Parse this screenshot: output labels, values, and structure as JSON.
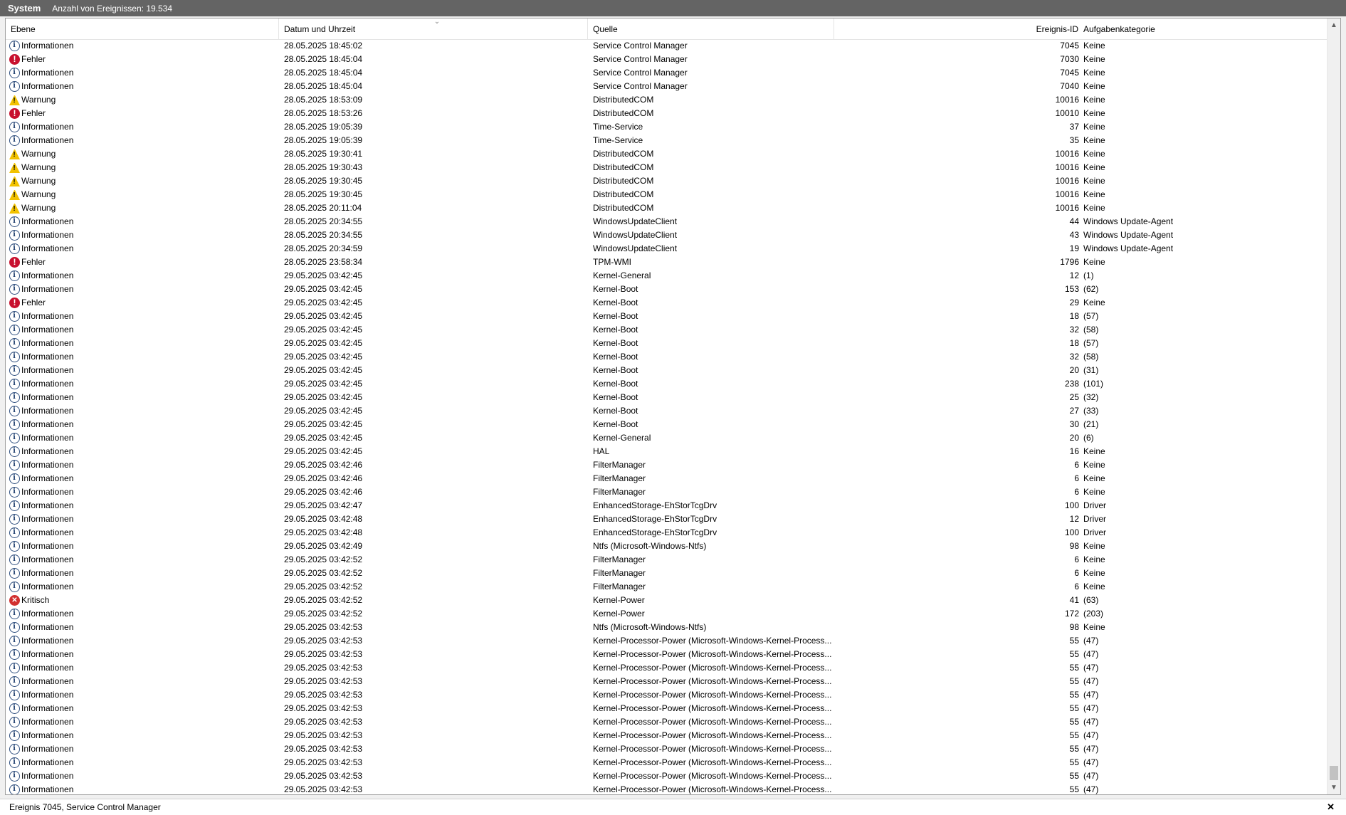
{
  "window": {
    "log_name": "System",
    "event_count": "Anzahl von Ereignissen: 19.534"
  },
  "columns": {
    "level": "Ebene",
    "datetime": "Datum und Uhrzeit",
    "source": "Quelle",
    "event_id": "Ereignis-ID",
    "category": "Aufgabenkategorie"
  },
  "icons": {
    "info": "info-icon",
    "error": "error-icon",
    "warning": "warning-icon",
    "critical": "critical-icon",
    "sort": "sort-caret-icon",
    "scroll_up": "scroll-up-icon",
    "scroll_down": "scroll-down-icon",
    "close": "close-icon"
  },
  "colors": {
    "titlebar": "#646464",
    "error": "#c8102e",
    "warning": "#f2c200",
    "info": "#2f4f7f"
  },
  "events": [
    {
      "level": "Informationen",
      "type": "info",
      "date": "28.05.2025 18:45:02",
      "source": "Service Control Manager",
      "id": "7045",
      "category": "Keine"
    },
    {
      "level": "Fehler",
      "type": "error",
      "date": "28.05.2025 18:45:04",
      "source": "Service Control Manager",
      "id": "7030",
      "category": "Keine"
    },
    {
      "level": "Informationen",
      "type": "info",
      "date": "28.05.2025 18:45:04",
      "source": "Service Control Manager",
      "id": "7045",
      "category": "Keine"
    },
    {
      "level": "Informationen",
      "type": "info",
      "date": "28.05.2025 18:45:04",
      "source": "Service Control Manager",
      "id": "7040",
      "category": "Keine"
    },
    {
      "level": "Warnung",
      "type": "warning",
      "date": "28.05.2025 18:53:09",
      "source": "DistributedCOM",
      "id": "10016",
      "category": "Keine"
    },
    {
      "level": "Fehler",
      "type": "error",
      "date": "28.05.2025 18:53:26",
      "source": "DistributedCOM",
      "id": "10010",
      "category": "Keine"
    },
    {
      "level": "Informationen",
      "type": "info",
      "date": "28.05.2025 19:05:39",
      "source": "Time-Service",
      "id": "37",
      "category": "Keine"
    },
    {
      "level": "Informationen",
      "type": "info",
      "date": "28.05.2025 19:05:39",
      "source": "Time-Service",
      "id": "35",
      "category": "Keine"
    },
    {
      "level": "Warnung",
      "type": "warning",
      "date": "28.05.2025 19:30:41",
      "source": "DistributedCOM",
      "id": "10016",
      "category": "Keine"
    },
    {
      "level": "Warnung",
      "type": "warning",
      "date": "28.05.2025 19:30:43",
      "source": "DistributedCOM",
      "id": "10016",
      "category": "Keine"
    },
    {
      "level": "Warnung",
      "type": "warning",
      "date": "28.05.2025 19:30:45",
      "source": "DistributedCOM",
      "id": "10016",
      "category": "Keine"
    },
    {
      "level": "Warnung",
      "type": "warning",
      "date": "28.05.2025 19:30:45",
      "source": "DistributedCOM",
      "id": "10016",
      "category": "Keine"
    },
    {
      "level": "Warnung",
      "type": "warning",
      "date": "28.05.2025 20:11:04",
      "source": "DistributedCOM",
      "id": "10016",
      "category": "Keine"
    },
    {
      "level": "Informationen",
      "type": "info",
      "date": "28.05.2025 20:34:55",
      "source": "WindowsUpdateClient",
      "id": "44",
      "category": "Windows Update-Agent"
    },
    {
      "level": "Informationen",
      "type": "info",
      "date": "28.05.2025 20:34:55",
      "source": "WindowsUpdateClient",
      "id": "43",
      "category": "Windows Update-Agent"
    },
    {
      "level": "Informationen",
      "type": "info",
      "date": "28.05.2025 20:34:59",
      "source": "WindowsUpdateClient",
      "id": "19",
      "category": "Windows Update-Agent"
    },
    {
      "level": "Fehler",
      "type": "error",
      "date": "28.05.2025 23:58:34",
      "source": "TPM-WMI",
      "id": "1796",
      "category": "Keine"
    },
    {
      "level": "Informationen",
      "type": "info",
      "date": "29.05.2025 03:42:45",
      "source": "Kernel-General",
      "id": "12",
      "category": "(1)"
    },
    {
      "level": "Informationen",
      "type": "info",
      "date": "29.05.2025 03:42:45",
      "source": "Kernel-Boot",
      "id": "153",
      "category": "(62)"
    },
    {
      "level": "Fehler",
      "type": "error",
      "date": "29.05.2025 03:42:45",
      "source": "Kernel-Boot",
      "id": "29",
      "category": "Keine"
    },
    {
      "level": "Informationen",
      "type": "info",
      "date": "29.05.2025 03:42:45",
      "source": "Kernel-Boot",
      "id": "18",
      "category": "(57)"
    },
    {
      "level": "Informationen",
      "type": "info",
      "date": "29.05.2025 03:42:45",
      "source": "Kernel-Boot",
      "id": "32",
      "category": "(58)"
    },
    {
      "level": "Informationen",
      "type": "info",
      "date": "29.05.2025 03:42:45",
      "source": "Kernel-Boot",
      "id": "18",
      "category": "(57)"
    },
    {
      "level": "Informationen",
      "type": "info",
      "date": "29.05.2025 03:42:45",
      "source": "Kernel-Boot",
      "id": "32",
      "category": "(58)"
    },
    {
      "level": "Informationen",
      "type": "info",
      "date": "29.05.2025 03:42:45",
      "source": "Kernel-Boot",
      "id": "20",
      "category": "(31)"
    },
    {
      "level": "Informationen",
      "type": "info",
      "date": "29.05.2025 03:42:45",
      "source": "Kernel-Boot",
      "id": "238",
      "category": "(101)"
    },
    {
      "level": "Informationen",
      "type": "info",
      "date": "29.05.2025 03:42:45",
      "source": "Kernel-Boot",
      "id": "25",
      "category": "(32)"
    },
    {
      "level": "Informationen",
      "type": "info",
      "date": "29.05.2025 03:42:45",
      "source": "Kernel-Boot",
      "id": "27",
      "category": "(33)"
    },
    {
      "level": "Informationen",
      "type": "info",
      "date": "29.05.2025 03:42:45",
      "source": "Kernel-Boot",
      "id": "30",
      "category": "(21)"
    },
    {
      "level": "Informationen",
      "type": "info",
      "date": "29.05.2025 03:42:45",
      "source": "Kernel-General",
      "id": "20",
      "category": "(6)"
    },
    {
      "level": "Informationen",
      "type": "info",
      "date": "29.05.2025 03:42:45",
      "source": "HAL",
      "id": "16",
      "category": "Keine"
    },
    {
      "level": "Informationen",
      "type": "info",
      "date": "29.05.2025 03:42:46",
      "source": "FilterManager",
      "id": "6",
      "category": "Keine"
    },
    {
      "level": "Informationen",
      "type": "info",
      "date": "29.05.2025 03:42:46",
      "source": "FilterManager",
      "id": "6",
      "category": "Keine"
    },
    {
      "level": "Informationen",
      "type": "info",
      "date": "29.05.2025 03:42:46",
      "source": "FilterManager",
      "id": "6",
      "category": "Keine"
    },
    {
      "level": "Informationen",
      "type": "info",
      "date": "29.05.2025 03:42:47",
      "source": "EnhancedStorage-EhStorTcgDrv",
      "id": "100",
      "category": "Driver"
    },
    {
      "level": "Informationen",
      "type": "info",
      "date": "29.05.2025 03:42:48",
      "source": "EnhancedStorage-EhStorTcgDrv",
      "id": "12",
      "category": "Driver"
    },
    {
      "level": "Informationen",
      "type": "info",
      "date": "29.05.2025 03:42:48",
      "source": "EnhancedStorage-EhStorTcgDrv",
      "id": "100",
      "category": "Driver"
    },
    {
      "level": "Informationen",
      "type": "info",
      "date": "29.05.2025 03:42:49",
      "source": "Ntfs (Microsoft-Windows-Ntfs)",
      "id": "98",
      "category": "Keine"
    },
    {
      "level": "Informationen",
      "type": "info",
      "date": "29.05.2025 03:42:52",
      "source": "FilterManager",
      "id": "6",
      "category": "Keine"
    },
    {
      "level": "Informationen",
      "type": "info",
      "date": "29.05.2025 03:42:52",
      "source": "FilterManager",
      "id": "6",
      "category": "Keine"
    },
    {
      "level": "Informationen",
      "type": "info",
      "date": "29.05.2025 03:42:52",
      "source": "FilterManager",
      "id": "6",
      "category": "Keine"
    },
    {
      "level": "Kritisch",
      "type": "critical",
      "date": "29.05.2025 03:42:52",
      "source": "Kernel-Power",
      "id": "41",
      "category": "(63)"
    },
    {
      "level": "Informationen",
      "type": "info",
      "date": "29.05.2025 03:42:52",
      "source": "Kernel-Power",
      "id": "172",
      "category": "(203)"
    },
    {
      "level": "Informationen",
      "type": "info",
      "date": "29.05.2025 03:42:53",
      "source": "Ntfs (Microsoft-Windows-Ntfs)",
      "id": "98",
      "category": "Keine"
    },
    {
      "level": "Informationen",
      "type": "info",
      "date": "29.05.2025 03:42:53",
      "source": "Kernel-Processor-Power (Microsoft-Windows-Kernel-Process...",
      "id": "55",
      "category": "(47)"
    },
    {
      "level": "Informationen",
      "type": "info",
      "date": "29.05.2025 03:42:53",
      "source": "Kernel-Processor-Power (Microsoft-Windows-Kernel-Process...",
      "id": "55",
      "category": "(47)"
    },
    {
      "level": "Informationen",
      "type": "info",
      "date": "29.05.2025 03:42:53",
      "source": "Kernel-Processor-Power (Microsoft-Windows-Kernel-Process...",
      "id": "55",
      "category": "(47)"
    },
    {
      "level": "Informationen",
      "type": "info",
      "date": "29.05.2025 03:42:53",
      "source": "Kernel-Processor-Power (Microsoft-Windows-Kernel-Process...",
      "id": "55",
      "category": "(47)"
    },
    {
      "level": "Informationen",
      "type": "info",
      "date": "29.05.2025 03:42:53",
      "source": "Kernel-Processor-Power (Microsoft-Windows-Kernel-Process...",
      "id": "55",
      "category": "(47)"
    },
    {
      "level": "Informationen",
      "type": "info",
      "date": "29.05.2025 03:42:53",
      "source": "Kernel-Processor-Power (Microsoft-Windows-Kernel-Process...",
      "id": "55",
      "category": "(47)"
    },
    {
      "level": "Informationen",
      "type": "info",
      "date": "29.05.2025 03:42:53",
      "source": "Kernel-Processor-Power (Microsoft-Windows-Kernel-Process...",
      "id": "55",
      "category": "(47)"
    },
    {
      "level": "Informationen",
      "type": "info",
      "date": "29.05.2025 03:42:53",
      "source": "Kernel-Processor-Power (Microsoft-Windows-Kernel-Process...",
      "id": "55",
      "category": "(47)"
    },
    {
      "level": "Informationen",
      "type": "info",
      "date": "29.05.2025 03:42:53",
      "source": "Kernel-Processor-Power (Microsoft-Windows-Kernel-Process...",
      "id": "55",
      "category": "(47)"
    },
    {
      "level": "Informationen",
      "type": "info",
      "date": "29.05.2025 03:42:53",
      "source": "Kernel-Processor-Power (Microsoft-Windows-Kernel-Process...",
      "id": "55",
      "category": "(47)"
    },
    {
      "level": "Informationen",
      "type": "info",
      "date": "29.05.2025 03:42:53",
      "source": "Kernel-Processor-Power (Microsoft-Windows-Kernel-Process...",
      "id": "55",
      "category": "(47)"
    },
    {
      "level": "Informationen",
      "type": "info",
      "date": "29.05.2025 03:42:53",
      "source": "Kernel-Processor-Power (Microsoft-Windows-Kernel-Process...",
      "id": "55",
      "category": "(47)"
    }
  ],
  "status": {
    "selected_event": "Ereignis 7045, Service Control Manager"
  }
}
